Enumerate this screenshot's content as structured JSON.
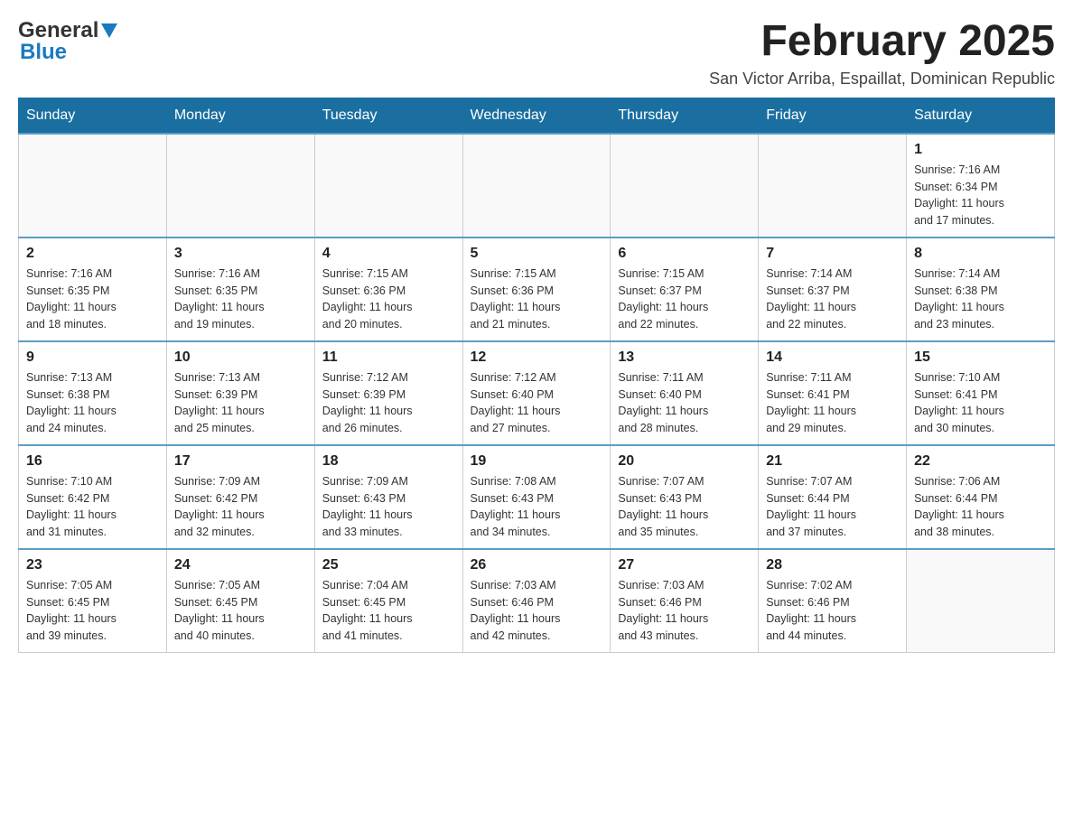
{
  "logo": {
    "general": "General",
    "blue": "Blue"
  },
  "header": {
    "title": "February 2025",
    "subtitle": "San Victor Arriba, Espaillat, Dominican Republic"
  },
  "days_of_week": [
    "Sunday",
    "Monday",
    "Tuesday",
    "Wednesday",
    "Thursday",
    "Friday",
    "Saturday"
  ],
  "weeks": [
    {
      "cells": [
        {
          "day": "",
          "info": ""
        },
        {
          "day": "",
          "info": ""
        },
        {
          "day": "",
          "info": ""
        },
        {
          "day": "",
          "info": ""
        },
        {
          "day": "",
          "info": ""
        },
        {
          "day": "",
          "info": ""
        },
        {
          "day": "1",
          "info": "Sunrise: 7:16 AM\nSunset: 6:34 PM\nDaylight: 11 hours\nand 17 minutes."
        }
      ]
    },
    {
      "cells": [
        {
          "day": "2",
          "info": "Sunrise: 7:16 AM\nSunset: 6:35 PM\nDaylight: 11 hours\nand 18 minutes."
        },
        {
          "day": "3",
          "info": "Sunrise: 7:16 AM\nSunset: 6:35 PM\nDaylight: 11 hours\nand 19 minutes."
        },
        {
          "day": "4",
          "info": "Sunrise: 7:15 AM\nSunset: 6:36 PM\nDaylight: 11 hours\nand 20 minutes."
        },
        {
          "day": "5",
          "info": "Sunrise: 7:15 AM\nSunset: 6:36 PM\nDaylight: 11 hours\nand 21 minutes."
        },
        {
          "day": "6",
          "info": "Sunrise: 7:15 AM\nSunset: 6:37 PM\nDaylight: 11 hours\nand 22 minutes."
        },
        {
          "day": "7",
          "info": "Sunrise: 7:14 AM\nSunset: 6:37 PM\nDaylight: 11 hours\nand 22 minutes."
        },
        {
          "day": "8",
          "info": "Sunrise: 7:14 AM\nSunset: 6:38 PM\nDaylight: 11 hours\nand 23 minutes."
        }
      ]
    },
    {
      "cells": [
        {
          "day": "9",
          "info": "Sunrise: 7:13 AM\nSunset: 6:38 PM\nDaylight: 11 hours\nand 24 minutes."
        },
        {
          "day": "10",
          "info": "Sunrise: 7:13 AM\nSunset: 6:39 PM\nDaylight: 11 hours\nand 25 minutes."
        },
        {
          "day": "11",
          "info": "Sunrise: 7:12 AM\nSunset: 6:39 PM\nDaylight: 11 hours\nand 26 minutes."
        },
        {
          "day": "12",
          "info": "Sunrise: 7:12 AM\nSunset: 6:40 PM\nDaylight: 11 hours\nand 27 minutes."
        },
        {
          "day": "13",
          "info": "Sunrise: 7:11 AM\nSunset: 6:40 PM\nDaylight: 11 hours\nand 28 minutes."
        },
        {
          "day": "14",
          "info": "Sunrise: 7:11 AM\nSunset: 6:41 PM\nDaylight: 11 hours\nand 29 minutes."
        },
        {
          "day": "15",
          "info": "Sunrise: 7:10 AM\nSunset: 6:41 PM\nDaylight: 11 hours\nand 30 minutes."
        }
      ]
    },
    {
      "cells": [
        {
          "day": "16",
          "info": "Sunrise: 7:10 AM\nSunset: 6:42 PM\nDaylight: 11 hours\nand 31 minutes."
        },
        {
          "day": "17",
          "info": "Sunrise: 7:09 AM\nSunset: 6:42 PM\nDaylight: 11 hours\nand 32 minutes."
        },
        {
          "day": "18",
          "info": "Sunrise: 7:09 AM\nSunset: 6:43 PM\nDaylight: 11 hours\nand 33 minutes."
        },
        {
          "day": "19",
          "info": "Sunrise: 7:08 AM\nSunset: 6:43 PM\nDaylight: 11 hours\nand 34 minutes."
        },
        {
          "day": "20",
          "info": "Sunrise: 7:07 AM\nSunset: 6:43 PM\nDaylight: 11 hours\nand 35 minutes."
        },
        {
          "day": "21",
          "info": "Sunrise: 7:07 AM\nSunset: 6:44 PM\nDaylight: 11 hours\nand 37 minutes."
        },
        {
          "day": "22",
          "info": "Sunrise: 7:06 AM\nSunset: 6:44 PM\nDaylight: 11 hours\nand 38 minutes."
        }
      ]
    },
    {
      "cells": [
        {
          "day": "23",
          "info": "Sunrise: 7:05 AM\nSunset: 6:45 PM\nDaylight: 11 hours\nand 39 minutes."
        },
        {
          "day": "24",
          "info": "Sunrise: 7:05 AM\nSunset: 6:45 PM\nDaylight: 11 hours\nand 40 minutes."
        },
        {
          "day": "25",
          "info": "Sunrise: 7:04 AM\nSunset: 6:45 PM\nDaylight: 11 hours\nand 41 minutes."
        },
        {
          "day": "26",
          "info": "Sunrise: 7:03 AM\nSunset: 6:46 PM\nDaylight: 11 hours\nand 42 minutes."
        },
        {
          "day": "27",
          "info": "Sunrise: 7:03 AM\nSunset: 6:46 PM\nDaylight: 11 hours\nand 43 minutes."
        },
        {
          "day": "28",
          "info": "Sunrise: 7:02 AM\nSunset: 6:46 PM\nDaylight: 11 hours\nand 44 minutes."
        },
        {
          "day": "",
          "info": ""
        }
      ]
    }
  ]
}
